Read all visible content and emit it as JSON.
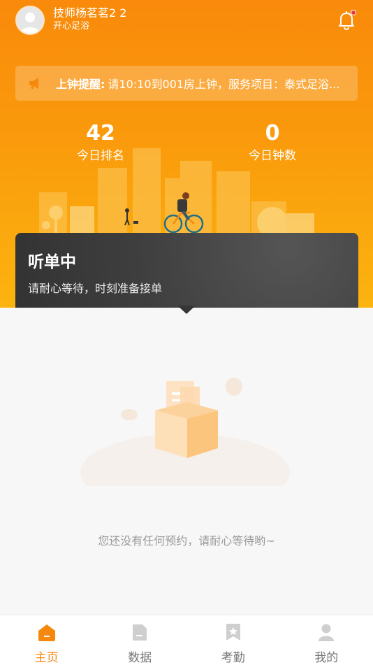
{
  "header": {
    "user_name": "技师杨茗茗2 2",
    "shop_name": "开心足浴"
  },
  "notice": {
    "label": "上钟提醒:",
    "text": "请10:10到001房上钟，服务项目：泰式足浴..."
  },
  "stats": [
    {
      "value": "42",
      "label": "今日排名"
    },
    {
      "value": "0",
      "label": "今日钟数"
    }
  ],
  "status_card": {
    "title": "听单中",
    "subtitle": "请耐心等待，时刻准备接单"
  },
  "empty_state": {
    "message": "您还没有任何预约，请耐心等待哟~"
  },
  "tabs": [
    {
      "label": "主页",
      "icon": "home-icon",
      "active": true
    },
    {
      "label": "数据",
      "icon": "document-icon",
      "active": false
    },
    {
      "label": "考勤",
      "icon": "bookmark-star-icon",
      "active": false
    },
    {
      "label": "我的",
      "icon": "person-icon",
      "active": false
    }
  ],
  "colors": {
    "accent": "#f6890d",
    "card_dark": "#3e3e3e",
    "background": "#f7f7f7"
  }
}
